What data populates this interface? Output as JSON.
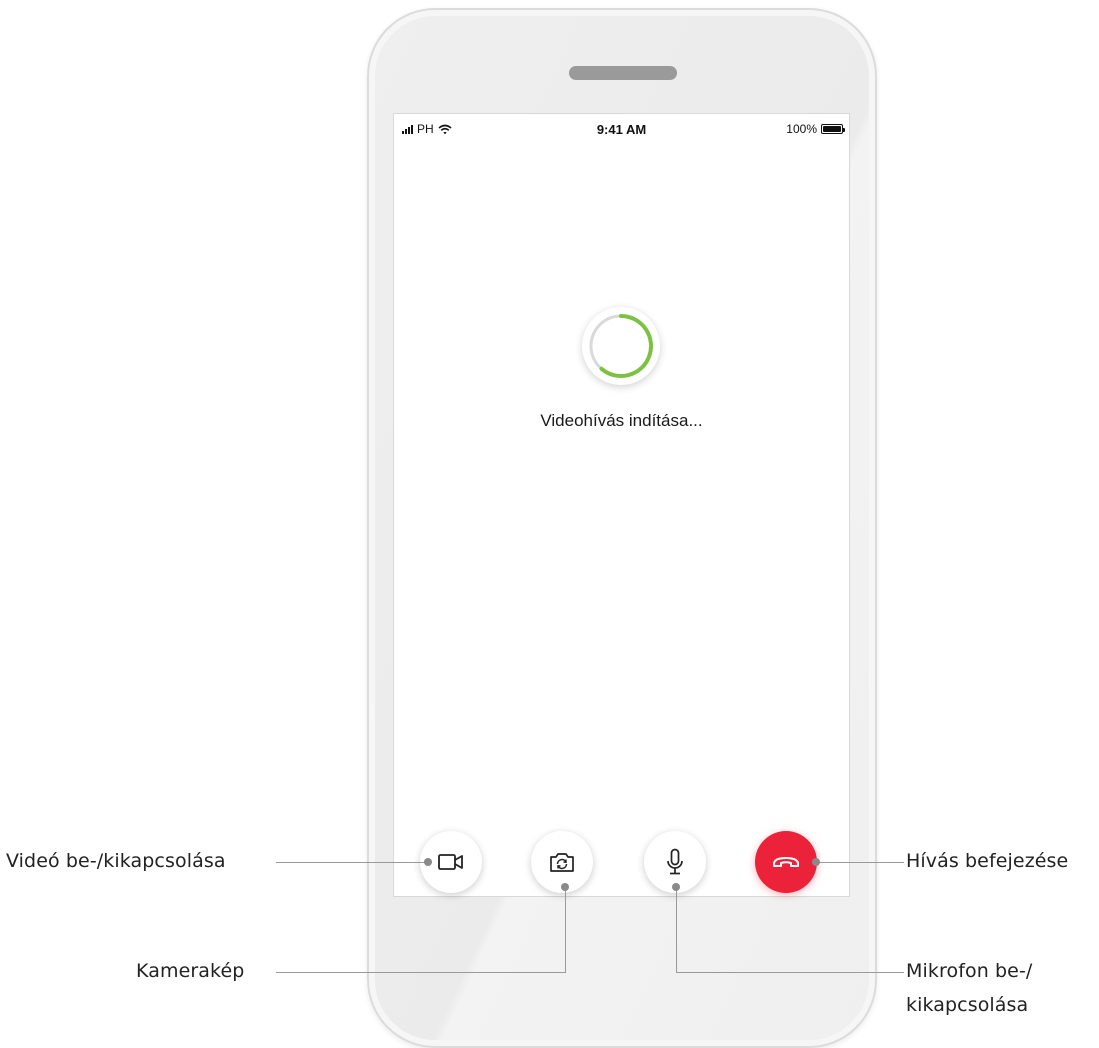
{
  "status_bar": {
    "carrier": "PH",
    "time": "9:41 AM",
    "battery": "100%"
  },
  "call": {
    "loading_text": "Videohívás indítása..."
  },
  "controls": [
    {
      "name": "video-toggle",
      "icon": "video-camera-icon"
    },
    {
      "name": "camera-switch",
      "icon": "camera-switch-icon"
    },
    {
      "name": "microphone-toggle",
      "icon": "microphone-icon"
    },
    {
      "name": "end-call",
      "icon": "hang-up-icon"
    }
  ],
  "callouts": {
    "video": "Videó be-/kikapcsolása",
    "camera": "Kamerakép",
    "mic_line1": "Mikrofon be-/",
    "mic_line2": "kikapcsolása",
    "end_call": "Hívás befejezése"
  },
  "colors": {
    "end_call": "#eb2239",
    "spinner_arc": "#7dc143",
    "spinner_track": "#d9d9d9"
  }
}
